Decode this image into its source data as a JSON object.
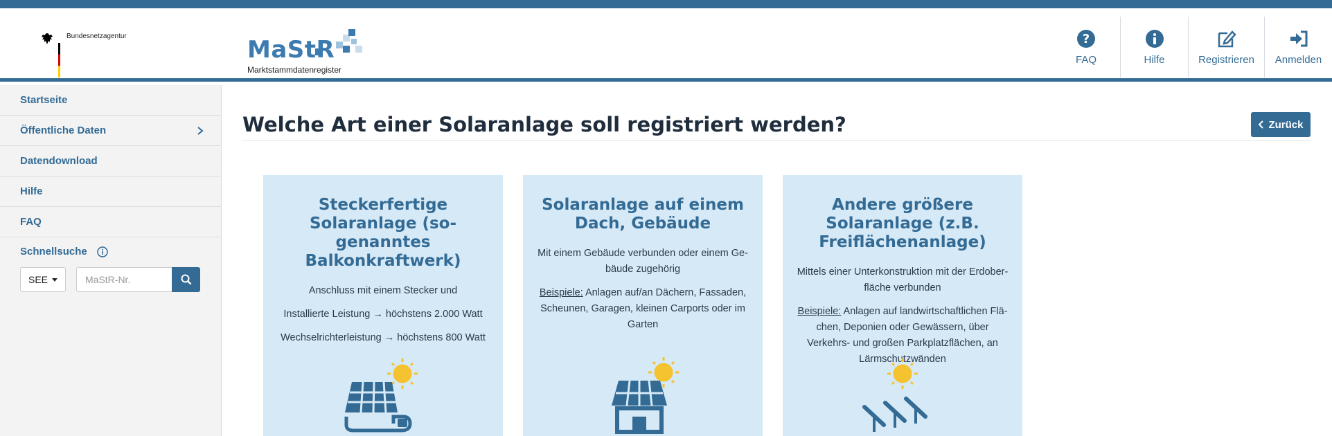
{
  "header": {
    "agency_name": "Bundesnetzagentur",
    "logo_text": "MaStR",
    "logo_subtitle": "Marktstammdatenregister",
    "nav": [
      {
        "label": "FAQ",
        "icon": "question-circle-icon"
      },
      {
        "label": "Hilfe",
        "icon": "info-circle-icon"
      },
      {
        "label": "Registrieren",
        "icon": "edit-icon"
      },
      {
        "label": "Anmelden",
        "icon": "sign-in-icon"
      }
    ]
  },
  "sidebar": {
    "items": [
      {
        "label": "Startseite"
      },
      {
        "label": "Öffentliche Daten"
      },
      {
        "label": "Datendownload"
      },
      {
        "label": "Hilfe"
      },
      {
        "label": "FAQ"
      }
    ],
    "quick_search": {
      "title": "Schnellsuche",
      "select_value": "SEE",
      "placeholder": "MaStR-Nr."
    }
  },
  "main": {
    "title": "Welche Art einer Solaranlage soll registriert werden?",
    "back_label": "Zurück",
    "cards": [
      {
        "title": "Steckerfertige Solaranlage (so-genanntes Balkonkraftwerk)",
        "lines": [
          "Anschluss mit einem Stecker und",
          "Installierte Leistung → höchstens 2.000 Watt",
          "Wechselrichterleistung → höchstens 800 Watt"
        ]
      },
      {
        "title": "Solaranlage auf einem Dach, Gebäude",
        "description": "Mit einem Gebäude verbunden oder einem Ge-bäude zugehörig",
        "example_label": "Beispiele:",
        "example_text": " Anlagen auf/an Dächern, Fassaden, Scheunen, Garagen, kleinen Carports oder im Garten"
      },
      {
        "title": "Andere größere Solaranlage (z.B. Freiflächenanlage)",
        "description": "Mittels einer Unterkonstruktion mit der Erdober-fläche verbunden",
        "example_label": "Beispiele:",
        "example_text": " Anlagen auf landwirtschaftlichen Flä-chen, Deponien oder Gewässern, über Verkehrs- und großen Parkplatzflächen, an Lärmschutzwänden"
      }
    ]
  },
  "colors": {
    "brand": "#336b95",
    "card_bg": "#d6e9f6",
    "sun": "#f5c230",
    "sidebar_bg": "#f3f3f3"
  }
}
